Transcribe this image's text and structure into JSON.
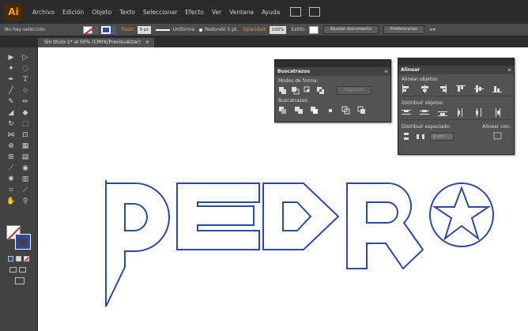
{
  "app": {
    "logo": "Ai"
  },
  "menu": {
    "items": [
      "Archivo",
      "Edición",
      "Objeto",
      "Texto",
      "Seleccionar",
      "Efecto",
      "Ver",
      "Ventana",
      "Ayuda"
    ]
  },
  "control": {
    "selection_status": "No hay selección",
    "stroke_label": "Trazo:",
    "stroke_weight": "5 pt",
    "profile": "Uniforme",
    "brush": "Redondo 5 pt.",
    "opacity_label": "Opacidad:",
    "opacity_value": "100%",
    "style_label": "Estilo:",
    "doc_setup_button": "Ajustar documento",
    "prefs_button": "Preferencias",
    "colors": {
      "stroke": "#2b4aa8",
      "accent": "#f0912c"
    }
  },
  "document": {
    "tab_title": "Sin título-1* al 50% (CMYK/Previsualizar)",
    "close_glyph": "×"
  },
  "artwork": {
    "text": "PEDRO",
    "stroke_color": "#2b4aa8"
  },
  "pathfinder": {
    "title": "Buscatrazos",
    "shape_modes_label": "Modos de forma:",
    "expand_button": "Expandir",
    "pathfinders_label": "Buscatrazos:"
  },
  "align": {
    "title": "Alinear",
    "align_objects_label": "Alinear objetos:",
    "distribute_objects_label": "Distribuir objetos:",
    "distribute_spacing_label": "Distribuir espaciado:",
    "align_to_label": "Alinear con:",
    "spacing_value": "0 cm"
  }
}
